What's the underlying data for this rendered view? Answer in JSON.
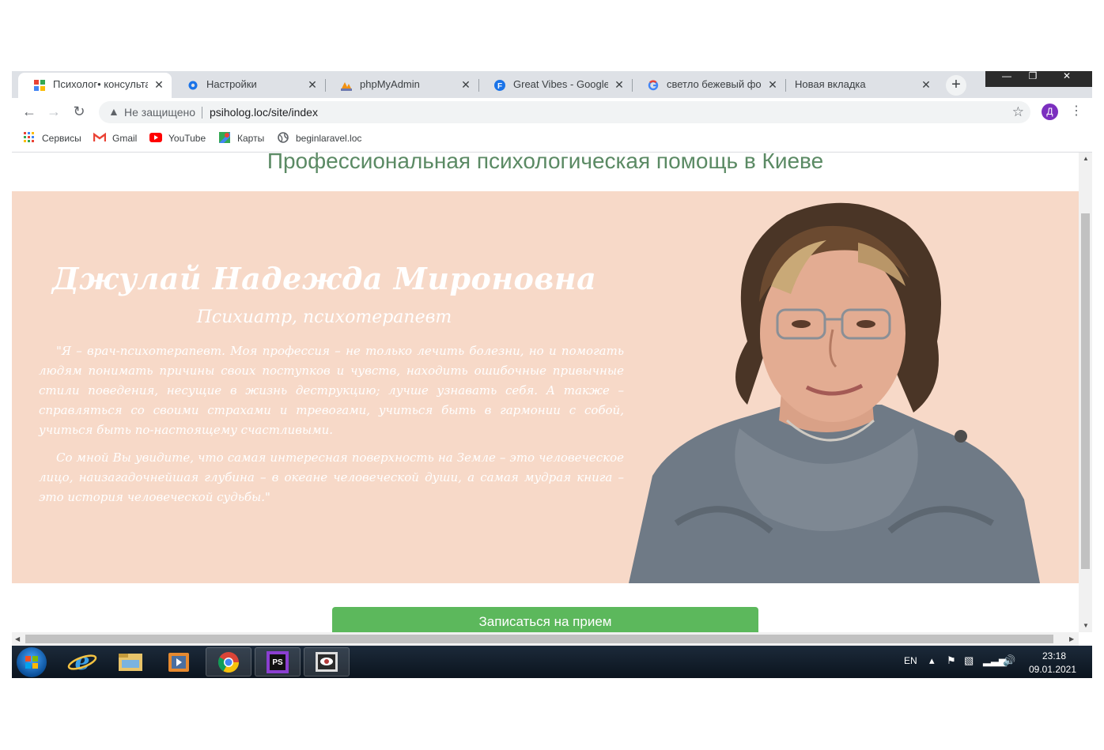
{
  "browser": {
    "tabs": [
      {
        "label": "Психолог• консультация",
        "icon": "site-favicon",
        "active": true
      },
      {
        "label": "Настройки",
        "icon": "gear-icon"
      },
      {
        "label": "phpMyAdmin",
        "icon": "pma-icon"
      },
      {
        "label": "Great Vibes - Google Fonts",
        "icon": "google-fonts-icon"
      },
      {
        "label": "светло бежевый фон сайта",
        "icon": "google-icon"
      },
      {
        "label": "Новая вкладка",
        "icon": ""
      }
    ],
    "tab_close_glyph": "✕",
    "new_tab_glyph": "+",
    "window_controls": {
      "minimize": "—",
      "restore": "❐",
      "close": "✕"
    },
    "address": {
      "security_text": "Не защищено",
      "url": "psiholog.loc/site/index"
    },
    "profile_initial": "Д",
    "bookmarks": [
      {
        "label": "Сервисы",
        "icon": "apps-grid-icon"
      },
      {
        "label": "Gmail",
        "icon": "gmail-icon"
      },
      {
        "label": "YouTube",
        "icon": "youtube-icon"
      },
      {
        "label": "Карты",
        "icon": "maps-icon"
      },
      {
        "label": "beginlaravel.loc",
        "icon": "globe-icon"
      }
    ]
  },
  "page": {
    "heading": "Профессиональная психологическая помощь в Киеве",
    "doctor_name": "Джулай Надежда Мироновна",
    "doctor_role": "Психиатр, психотерапевт",
    "quote_paragraph_1": "\"Я – врач-психотерапевт. Моя профессия – не только лечить болезни, но и помогать людям понимать причины своих поступков и чувств, находить ошибочные привычные стили поведения, несущие в жизнь деструкцию; лучше узнавать себя. А также – справляться со своими страхами и тревогами, учиться быть в гармонии с собой, учиться быть по-настоящему счастливыми.",
    "quote_paragraph_2": "Со мной Вы увидите, что самая интересная поверхность на Земле – это человеческое лицо, наизагадочнейшая глубина – в океане человеческой души, а самая мудрая книга – это история человеческой судьбы.\"",
    "book_button": "Записаться на прием",
    "colors": {
      "heading": "#5b8a64",
      "hero_bg": "#f7d9c8",
      "button": "#5cb85c"
    }
  },
  "taskbar": {
    "apps": [
      "windows-start",
      "internet-explorer",
      "file-explorer",
      "media-player",
      "chrome",
      "phpstorm",
      "image-viewer"
    ],
    "language": "EN",
    "time": "23:18",
    "date": "09.01.2021"
  }
}
